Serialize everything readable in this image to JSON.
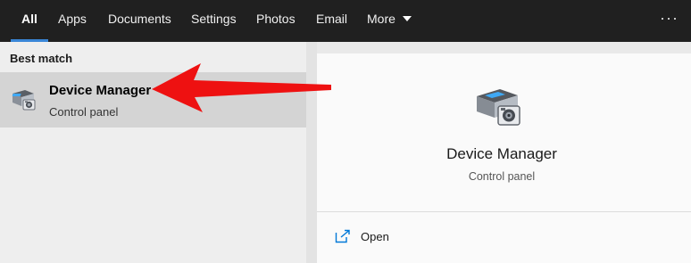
{
  "tabs": [
    {
      "label": "All",
      "active": true
    },
    {
      "label": "Apps"
    },
    {
      "label": "Documents"
    },
    {
      "label": "Settings"
    },
    {
      "label": "Photos"
    },
    {
      "label": "Email"
    },
    {
      "label": "More"
    }
  ],
  "overflow_label": "···",
  "results": {
    "section_label": "Best match",
    "best_match": {
      "title": "Device Manager",
      "subtitle": "Control panel",
      "icon": "device-manager-icon"
    }
  },
  "preview": {
    "title": "Device Manager",
    "subtitle": "Control panel",
    "icon": "device-manager-icon",
    "actions": [
      {
        "label": "Open",
        "icon": "open-icon"
      }
    ]
  },
  "colors": {
    "topbar": "#202020",
    "active_underline": "#3a86d7",
    "selected_row": "#d4d4d4",
    "arrow": "#ee1111",
    "open_icon": "#0078d7"
  }
}
